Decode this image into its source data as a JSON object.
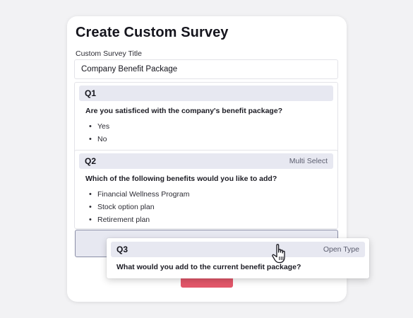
{
  "page": {
    "title": "Create Custom Survey",
    "title_label": "Custom Survey Title",
    "title_value": "Company Benefit Package"
  },
  "questions": [
    {
      "number": "Q1",
      "type": "",
      "text": "Are you satisficed with the company's benefit package?",
      "options": [
        "Yes",
        "No"
      ]
    },
    {
      "number": "Q2",
      "type": "Multi Select",
      "text": "Which of the following benefits would you like to add?",
      "options": [
        "Financial Wellness Program",
        "Stock option plan",
        "Retirement plan"
      ]
    },
    {
      "number": "Q3",
      "type": "Open Type",
      "text": "What would you add to the current benefit package?",
      "options": []
    }
  ],
  "colors": {
    "accent": "#e3576a",
    "question_header": "#e7e8f1",
    "drop_outline": "#8a8ea6"
  },
  "icons": {
    "cursor": "hand-pointer-icon",
    "bullet": "bullet-icon"
  }
}
